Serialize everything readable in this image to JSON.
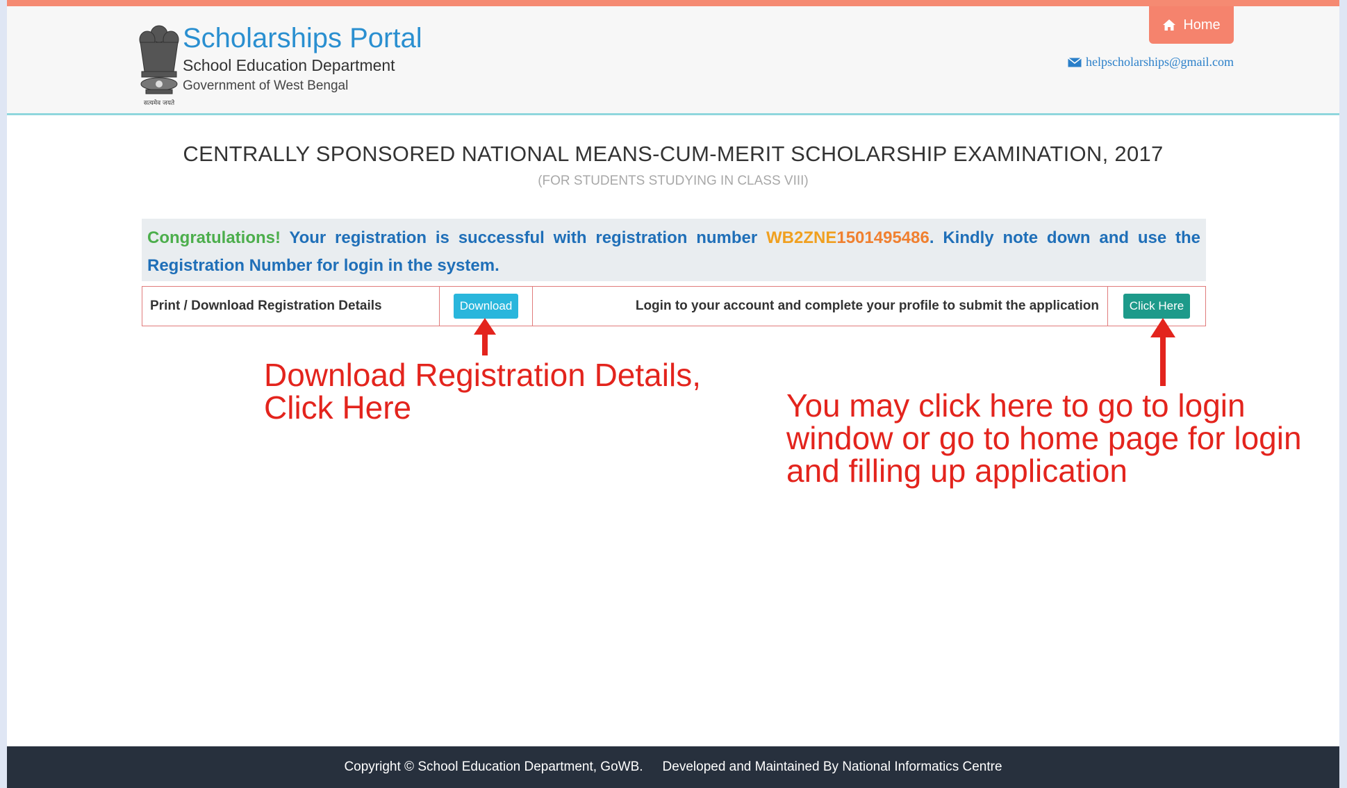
{
  "header": {
    "title": "Scholarships Portal",
    "department": "School Education Department",
    "government": "Government of West Bengal",
    "emblem_caption": "सत्यमेव जयते",
    "home_label": "Home",
    "email": "helpscholarships@gmail.com"
  },
  "main": {
    "title": "CENTRALLY SPONSORED NATIONAL MEANS-CUM-MERIT SCHOLARSHIP EXAMINATION, 2017",
    "subtitle": "(FOR STUDENTS STUDYING IN CLASS VIII)",
    "success": {
      "congrats": "Congratulations!",
      "message_pre": " Your registration is successful with registration number ",
      "regno_prefix": "WB2ZNE",
      "regno_number": "1501495486",
      "message_post": ". Kindly note down and use the Registration Number for login in the system."
    },
    "actions": {
      "print_label": "Print / Download Registration Details",
      "download_button": "Download",
      "login_text": "Login to your account and complete your profile to submit the application",
      "click_button": "Click Here"
    }
  },
  "annotations": {
    "download_note": "Download Registration Details,\nClick Here",
    "login_note": "You may click here to go to login\nwindow or go to home page for login\nand filling up application"
  },
  "footer": {
    "copyright": "Copyright © School Education Department, GoWB.",
    "developer": "Developed and Maintained By National Informatics Centre"
  },
  "colors": {
    "accent_top": "#f58a72",
    "title_blue": "#2a8fd0",
    "congrats_green": "#4cae4c",
    "regno_orange": "#f08030",
    "download_btn": "#29b6dc",
    "click_btn": "#1d9a8a",
    "annotation_red": "#e3241d",
    "footer_bg": "#27303d"
  }
}
